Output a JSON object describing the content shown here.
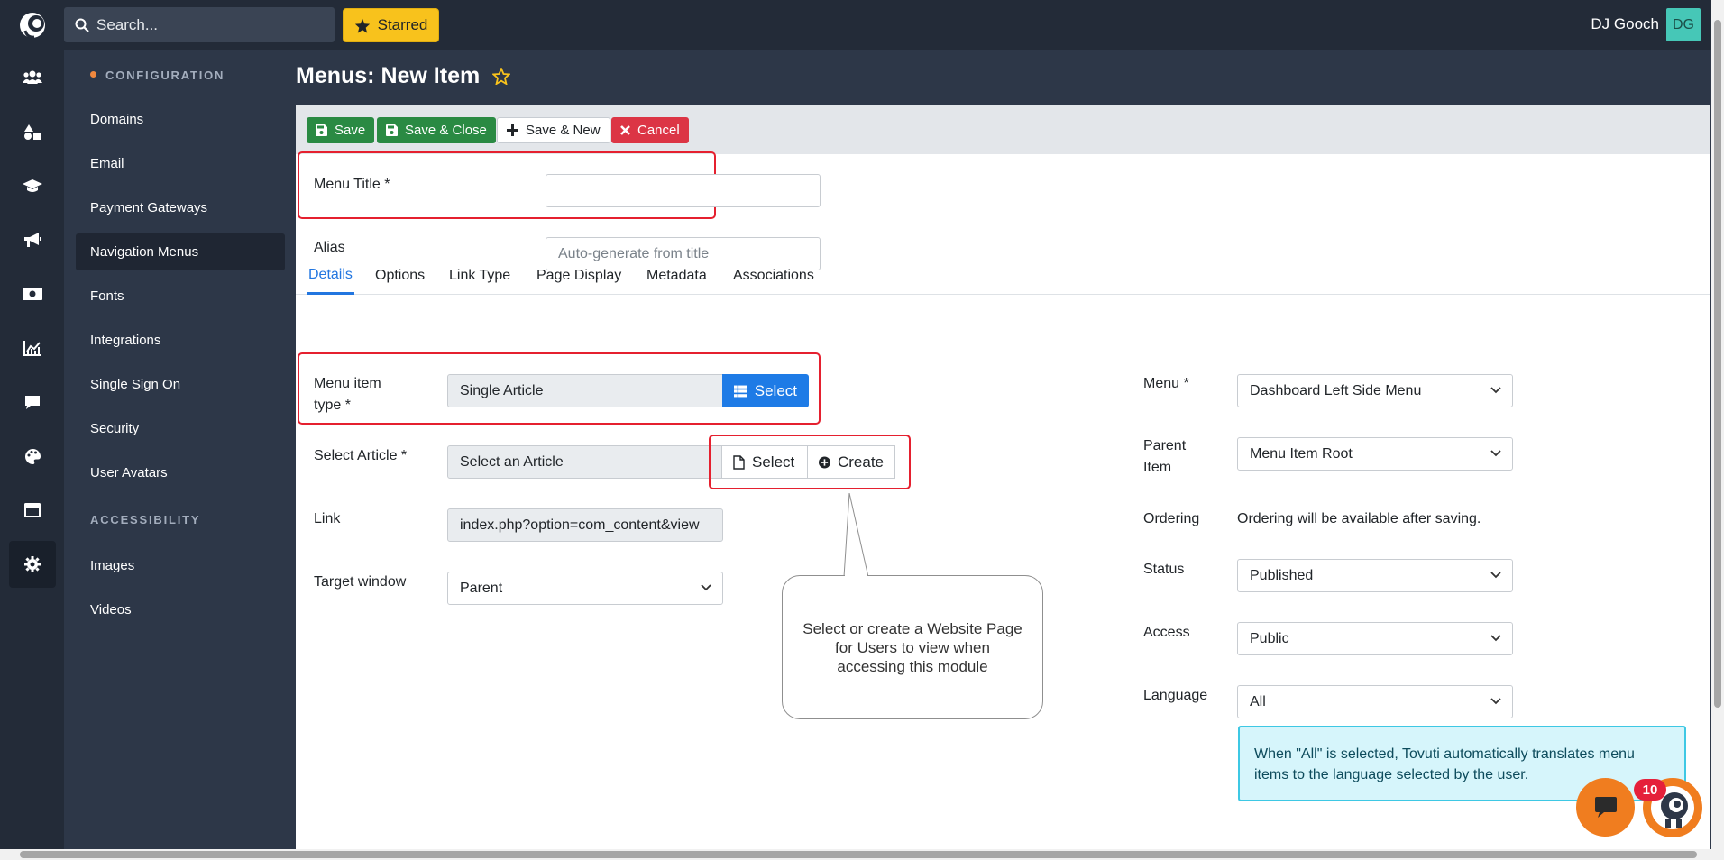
{
  "topbar": {
    "search_placeholder": "Search...",
    "starred_label": "Starred",
    "user_name": "DJ Gooch",
    "avatar_initials": "DG"
  },
  "rail": {
    "icons": [
      "users-icon",
      "shapes-icon",
      "graduation-cap-icon",
      "megaphone-icon",
      "money-icon",
      "chart-icon",
      "comment-icon",
      "palette-icon",
      "window-icon",
      "gear-icon"
    ],
    "active_icon": "gear-icon"
  },
  "sidebar": {
    "section_configuration": "CONFIGURATION",
    "items": [
      {
        "label": "Domains"
      },
      {
        "label": "Email"
      },
      {
        "label": "Payment Gateways"
      },
      {
        "label": "Navigation Menus"
      },
      {
        "label": "Fonts"
      },
      {
        "label": "Integrations"
      },
      {
        "label": "Single Sign On"
      },
      {
        "label": "Security"
      },
      {
        "label": "User Avatars"
      }
    ],
    "active_item": "Navigation Menus",
    "section_accessibility": "ACCESSIBILITY",
    "accessibility_items": [
      {
        "label": "Images"
      },
      {
        "label": "Videos"
      }
    ]
  },
  "page": {
    "title": "Menus: New Item"
  },
  "toolbar": {
    "save_label": "Save",
    "save_close_label": "Save & Close",
    "save_new_label": "Save & New",
    "cancel_label": "Cancel"
  },
  "form": {
    "menu_title_label": "Menu Title *",
    "menu_title_value": "",
    "alias_label": "Alias",
    "alias_placeholder": "Auto-generate from title"
  },
  "tabs": [
    {
      "label": "Details",
      "active": true
    },
    {
      "label": "Options"
    },
    {
      "label": "Link Type"
    },
    {
      "label": "Page Display"
    },
    {
      "label": "Metadata"
    },
    {
      "label": "Associations"
    }
  ],
  "details": {
    "menu_item_type_label_1": "Menu item",
    "menu_item_type_label_2": "type *",
    "menu_item_type_value": "Single Article",
    "select_button": "Select",
    "select_article_label": "Select Article *",
    "select_article_value": "Select an Article",
    "article_select_button": "Select",
    "article_create_button": "Create",
    "link_label": "Link",
    "link_value": "index.php?option=com_content&view",
    "target_window_label": "Target window",
    "target_window_value": "Parent"
  },
  "right": {
    "menu_label": "Menu *",
    "menu_value": "Dashboard Left Side Menu",
    "parent_item_label_1": "Parent",
    "parent_item_label_2": "Item",
    "parent_item_value": "Menu Item Root",
    "ordering_label": "Ordering",
    "ordering_value": "Ordering will be available after saving.",
    "status_label": "Status",
    "status_value": "Published",
    "access_label": "Access",
    "access_value": "Public",
    "language_label": "Language",
    "language_value": "All",
    "language_info": "When \"All\" is selected, Tovuti automatically translates menu items to the language selected by the user."
  },
  "callout": {
    "text": "Select or create a Website Page for Users to view when accessing this module"
  },
  "chat": {
    "badge_count": "10"
  },
  "colors": {
    "accent_blue": "#1e7be6",
    "save_green": "#2a8a43",
    "cancel_red": "#dc3545",
    "starred_yellow": "#f8c21c",
    "highlight_red": "#e5202f",
    "info_cyan": "#3ec8e4"
  }
}
